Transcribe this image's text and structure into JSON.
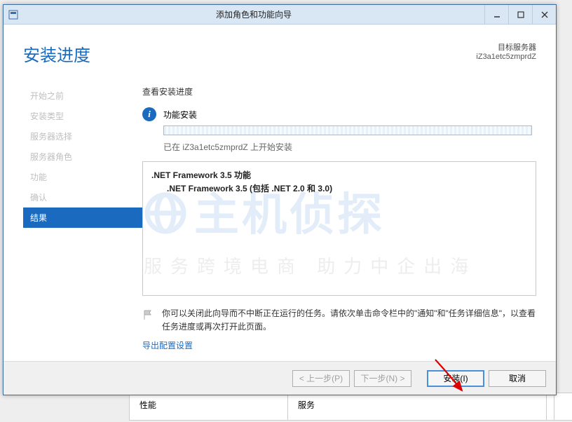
{
  "window": {
    "title": "添加角色和功能向导"
  },
  "header": {
    "page_title": "安装进度",
    "dest_label": "目标服务器",
    "dest_value": "iZ3a1etc5zmprdZ"
  },
  "sidebar": {
    "items": [
      {
        "label": "开始之前",
        "active": false
      },
      {
        "label": "安装类型",
        "active": false
      },
      {
        "label": "服务器选择",
        "active": false
      },
      {
        "label": "服务器角色",
        "active": false
      },
      {
        "label": "功能",
        "active": false
      },
      {
        "label": "确认",
        "active": false
      },
      {
        "label": "结果",
        "active": true
      }
    ]
  },
  "main": {
    "view_label": "查看安装进度",
    "status_text": "功能安装",
    "started_on_prefix": "已在 ",
    "started_on_server": "iZ3a1etc5zmprdZ",
    "started_on_suffix": " 上开始安装",
    "features": {
      "root": ".NET Framework 3.5 功能",
      "child": ".NET Framework 3.5 (包括 .NET 2.0 和 3.0)"
    },
    "note": "你可以关闭此向导而不中断正在运行的任务。请依次单击命令栏中的\"通知\"和\"任务详细信息\"，以查看任务进度或再次打开此页面。",
    "export_link": "导出配置设置"
  },
  "footer": {
    "prev": "< 上一步(P)",
    "next": "下一步(N) >",
    "install": "安装(I)",
    "cancel": "取消"
  },
  "bg": {
    "perf": "性能",
    "svc": "服务"
  },
  "watermark": {
    "title": "主机侦探",
    "sub": "服务跨境电商 助力中企出海"
  }
}
